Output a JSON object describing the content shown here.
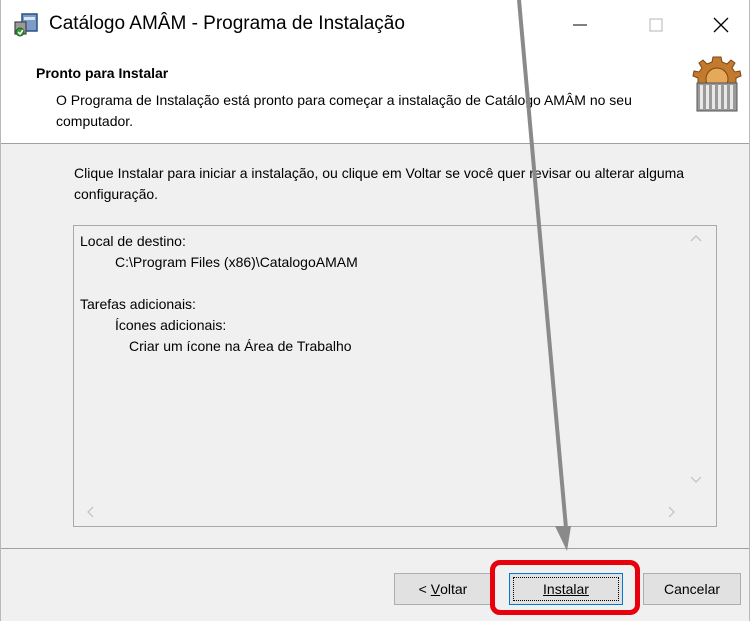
{
  "window": {
    "title": "Catálogo AMÂM - Programa de Instalação"
  },
  "header": {
    "title": "Pronto para Instalar",
    "description": "O Programa de Instalação está pronto para começar a instalação de Catálogo AMÂM no seu computador."
  },
  "main": {
    "instruction": "Clique Instalar para iniciar a instalação, ou clique em Voltar se você quer revisar ou alterar alguma configuração.",
    "memo": {
      "destination_label": "Local de destino:",
      "destination_path": "C:\\Program Files (x86)\\CatalogoAMAM",
      "tasks_label": "Tarefas adicionais:",
      "icons_label": "Ícones adicionais:",
      "desktop_icon_task": "Criar um ícone na Área de Trabalho"
    }
  },
  "buttons": {
    "back_prefix": "< ",
    "back_accel": "V",
    "back_rest": "oltar",
    "install_accel": "I",
    "install_rest": "nstalar",
    "cancel": "Cancelar"
  },
  "colors": {
    "highlight": "#e8000d",
    "arrow": "#8a8a8a",
    "focus_border": "#0078d7"
  }
}
